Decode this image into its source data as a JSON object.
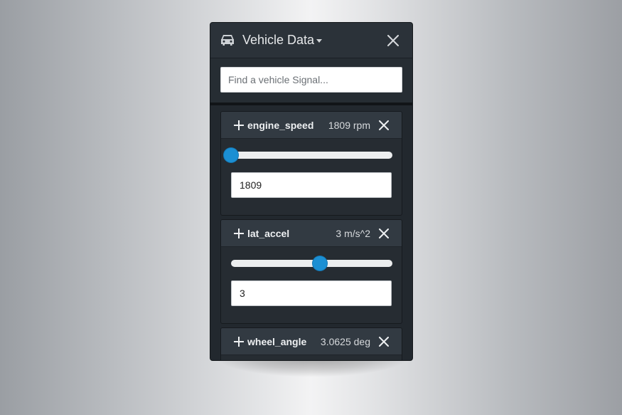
{
  "panel": {
    "title": "Vehicle Data",
    "icon": "car-icon"
  },
  "search": {
    "placeholder": "Find a vehicle Signal..."
  },
  "signals": [
    {
      "name": "engine_speed",
      "display": "1809 rpm",
      "value": "1809",
      "slider_fraction": 0.0
    },
    {
      "name": "lat_accel",
      "display": "3 m/s^2",
      "value": "3",
      "slider_fraction": 0.55
    },
    {
      "name": "wheel_angle",
      "display": "3.0625 deg",
      "value": "",
      "slider_fraction": null
    }
  ],
  "colors": {
    "accent": "#1b8fd3",
    "panel_bg": "#22282e",
    "header_bg": "#2b3239"
  }
}
